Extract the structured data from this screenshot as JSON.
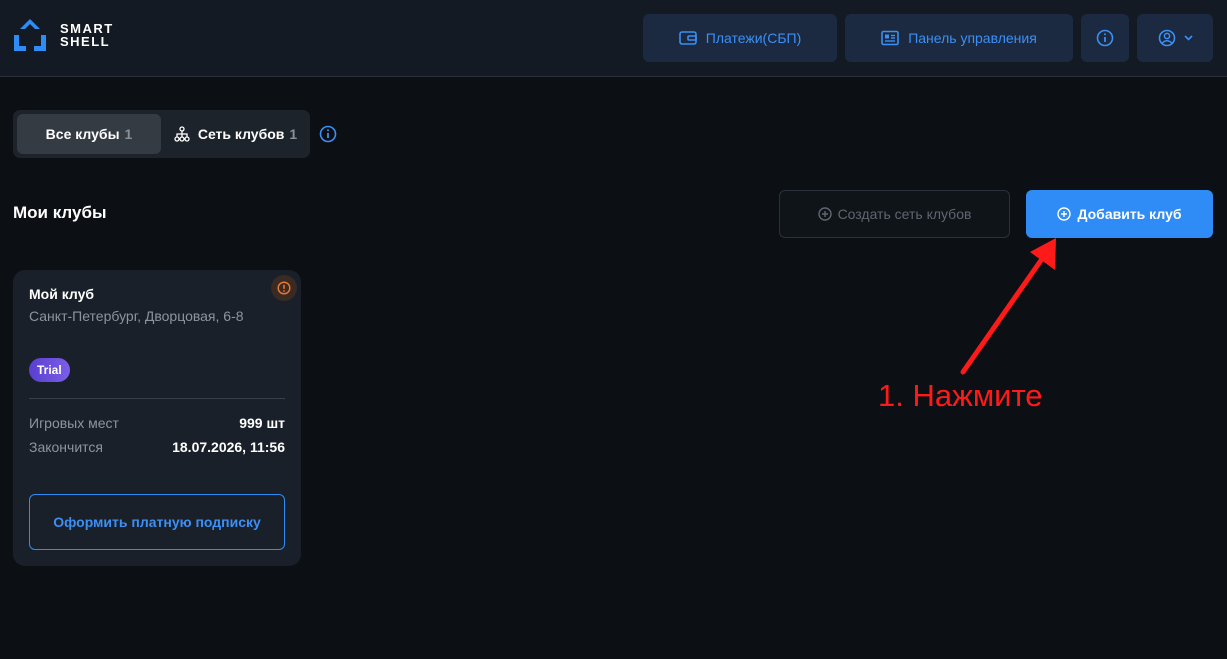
{
  "app": {
    "logo_line1": "SMART",
    "logo_line2": "SHELL"
  },
  "header": {
    "payments_label": "Платежи(СБП)",
    "panel_label": "Панель управления",
    "icons": [
      "wallet-icon",
      "dashboard-icon",
      "info-icon",
      "user-icon",
      "chevron-down-icon"
    ]
  },
  "tabs": [
    {
      "label": "Все клубы",
      "count": "1",
      "active": true
    },
    {
      "label": "Сеть клубов",
      "count": "1",
      "active": false
    }
  ],
  "section": {
    "title": "Мои клубы",
    "create_network_label": "Создать сеть клубов",
    "add_club_label": "Добавить клуб"
  },
  "club": {
    "name": "Мой клуб",
    "address": "Санкт-Петербург, Дворцовая, 6-8",
    "badge": "Trial",
    "seats_label": "Игровых мест",
    "seats_value": "999 шт",
    "expires_label": "Закончится",
    "expires_value": "18.07.2026, 11:56",
    "subscribe_label": "Оформить платную подписку"
  },
  "annotation": {
    "text": "1. Нажмите"
  },
  "colors": {
    "accent": "#2f8bf5",
    "background": "#0c1015",
    "header_bg": "#141a23",
    "card_bg": "#1a2029",
    "annotation": "#ff1a1a",
    "warning": "#e8762c"
  }
}
